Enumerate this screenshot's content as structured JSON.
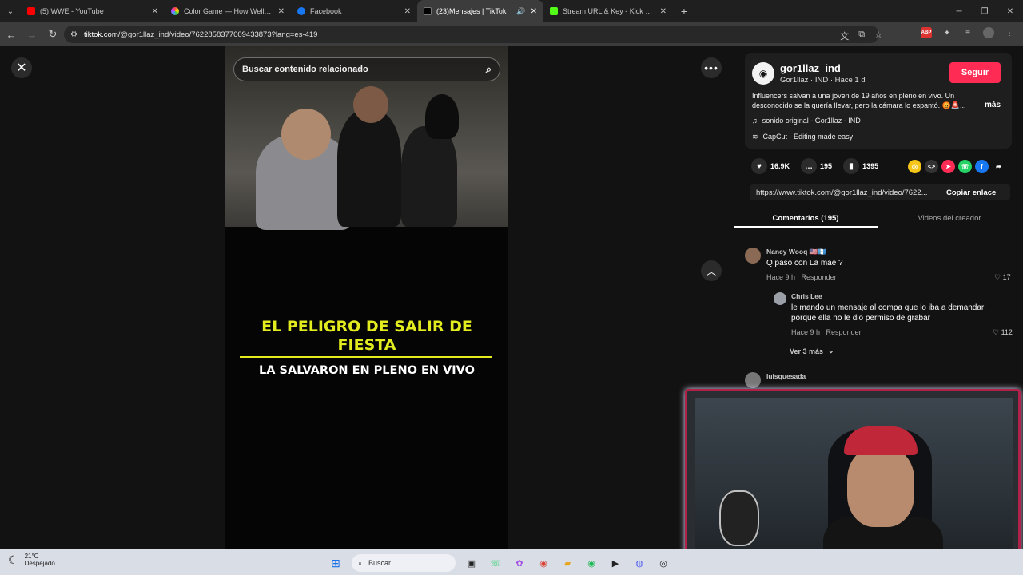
{
  "browser": {
    "tabs": [
      {
        "label": "(5) WWE - YouTube",
        "color": "#ff0000"
      },
      {
        "label": "Color Game — How Well Can You",
        "color": "#e05ae0"
      },
      {
        "label": "Facebook",
        "color": "#1877f2"
      },
      {
        "label": "(23)Mensajes | TikTok",
        "color": "#000000",
        "active": true
      },
      {
        "label": "Stream URL & Key - Kick Dashbo",
        "color": "#53fc18"
      }
    ],
    "url_host": "tiktok.com",
    "url_path": "/@gor1llaz_ind/video/7622858377009433873?lang=es-419"
  },
  "video": {
    "search_placeholder": "Buscar contenido relacionado",
    "headline": "EL PELIGRO DE SALIR DE FIESTA",
    "subline": "LA SALVARON EN PLENO EN VIVO"
  },
  "post": {
    "username": "gor1llaz_ind",
    "meta": "Gor1llaz · IND · Hace 1 d",
    "follow_label": "Seguir",
    "description": "Influencers salvan a una joven de 19 años en pleno en vivo. Un desconocido se la quería llevar, pero la cámara lo espantó. 😡🚨...",
    "more_label": "más",
    "music": "sonido original - Gor1llaz - IND",
    "capcut": "CapCut · Editing made easy",
    "likes": "16.9K",
    "comments_count": "195",
    "saves": "1395",
    "link": "https://www.tiktok.com/@gor1llaz_ind/video/7622...",
    "copy_label": "Copiar enlace",
    "tab_comments": "Comentarios (195)",
    "tab_creator": "Videos del creador"
  },
  "comments": [
    {
      "name": "Nancy Wooq 🇺🇸🇬🇹",
      "text": "Q paso con La mae ?",
      "time": "Hace 9 h",
      "reply": "Responder",
      "likes": "17"
    },
    {
      "name": "Chris Lee",
      "text": "le mando un mensaje al compa que lo iba a demandar porque ella no le dio permiso de grabar",
      "time": "Hace 9 h",
      "reply": "Responder",
      "likes": "112"
    },
    {
      "name": "luisquesada"
    }
  ],
  "ver_mas": "Ver 3 más",
  "taskbar": {
    "temp": "21°C",
    "weather": "Despejado",
    "search": "Buscar"
  }
}
